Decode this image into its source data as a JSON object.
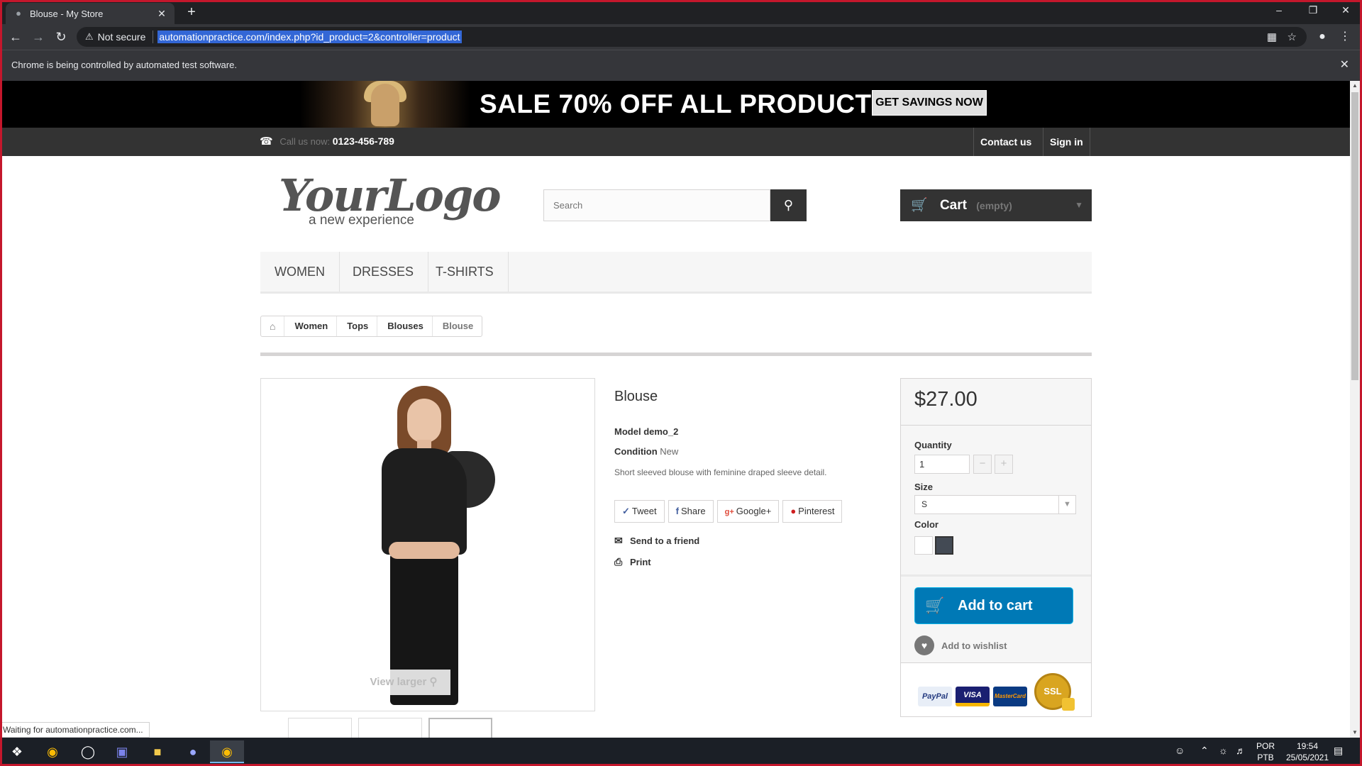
{
  "browser": {
    "tab_title": "Blouse - My Store",
    "tab_close": "✕",
    "new_tab": "+",
    "window_controls": {
      "minimize": "–",
      "maximize": "❐",
      "close": "✕"
    },
    "security_label": "Not secure",
    "url": "automationpractice.com/index.php?id_product=2&controller=product",
    "infobar_text": "Chrome is being controlled by automated test software.",
    "status_text": "Waiting for automationpractice.com..."
  },
  "banner": {
    "sale_text": "SALE 70% OFF ALL PRODUCTS",
    "cta_label": "GET SAVINGS NOW"
  },
  "topnav": {
    "call_label": "Call us now:",
    "phone": "0123-456-789",
    "contact_label": "Contact us",
    "signin_label": "Sign in"
  },
  "header": {
    "logo_main": "YourLogo",
    "logo_sub": "a new experience",
    "search_placeholder": "Search",
    "cart_label": "Cart",
    "cart_status": "(empty)"
  },
  "menu": {
    "items": [
      "WOMEN",
      "DRESSES",
      "T-SHIRTS"
    ]
  },
  "breadcrumb": {
    "items": [
      "Women",
      "Tops",
      "Blouses"
    ],
    "current": "Blouse"
  },
  "product": {
    "name": "Blouse",
    "model_label": "Model",
    "model_value": "demo_2",
    "condition_label": "Condition",
    "condition_value": "New",
    "description": "Short sleeved blouse with feminine draped sleeve detail.",
    "view_larger": "View larger",
    "social": {
      "tweet": "Tweet",
      "share": "Share",
      "google": "Google+",
      "pinterest": "Pinterest"
    },
    "send_to_friend": "Send to a friend",
    "print": "Print"
  },
  "buybox": {
    "price": "$27.00",
    "quantity_label": "Quantity",
    "quantity_value": "1",
    "size_label": "Size",
    "size_value": "S",
    "color_label": "Color",
    "colors": [
      "#ffffff",
      "#434a54"
    ],
    "add_to_cart": "Add to cart",
    "add_to_wishlist": "Add to wishlist",
    "payment_cards": [
      "PayPal",
      "VISA",
      "MasterCard"
    ],
    "ssl_badge": "SSL"
  },
  "taskbar": {
    "language": "POR",
    "keyboard": "PTB",
    "time": "19:54",
    "date": "25/05/2021"
  },
  "colors": {
    "accent_blue": "#0079b6",
    "chrome_dark": "#35363a",
    "nav_dark": "#333333"
  }
}
